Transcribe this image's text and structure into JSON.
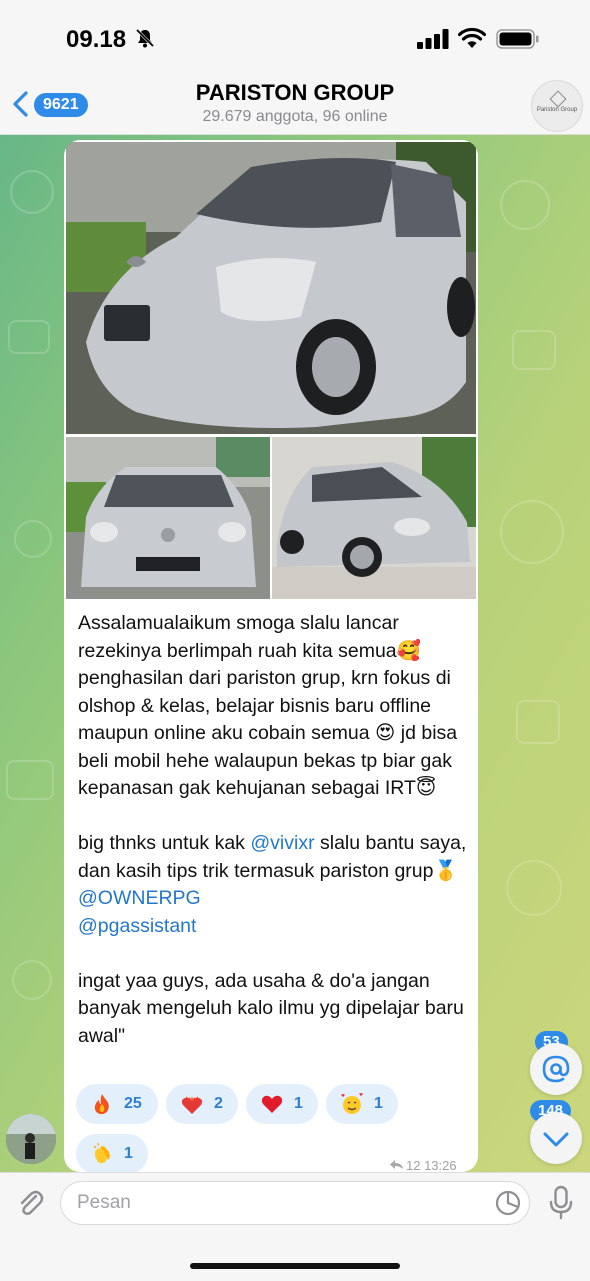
{
  "status_bar": {
    "time": "09.18"
  },
  "header": {
    "back_badge": "9621",
    "title": "PARISTON GROUP",
    "subtitle": "29.679 anggota, 96 online",
    "avatar_text": "Pariston Group"
  },
  "message": {
    "paragraph1": "Assalamualaikum smoga slalu lancar rezekinya berlimpah ruah kita semua🥰 penghasilan dari pariston grup, krn fokus di olshop & kelas, belajar bisnis baru offline maupun online aku cobain semua 😍 jd bisa beli mobil hehe walaupun bekas tp biar gak kepanasan gak kehujanan sebagai IRT😇",
    "p2_before": "big thnks untuk kak ",
    "mention1": "@vivixr",
    "p2_mid": " slalu bantu saya, dan kasih tips trik termasuk pariston grup🥇 ",
    "mention2": "@OWNERPG",
    "mention3": "@pgassistant",
    "paragraph3": "ingat yaa guys, ada usaha & do'a jangan banyak mengeluh kalo ilmu yg dipelajar baru awal\"",
    "reactions": [
      {
        "emoji": "fire-icon",
        "count": "25"
      },
      {
        "emoji": "heart-on-fire-icon",
        "count": "2"
      },
      {
        "emoji": "red-heart-icon",
        "count": "1"
      },
      {
        "emoji": "smiling-face-with-hearts-icon",
        "count": "1"
      },
      {
        "emoji": "clapping-hands-icon",
        "count": "1"
      }
    ],
    "meta": "12  13:26"
  },
  "floating": {
    "mentions_count": "53",
    "unread_count": "148"
  },
  "input": {
    "placeholder": "Pesan"
  },
  "colors": {
    "accent": "#2f8be8",
    "mention": "#2378c9",
    "reaction_bg": "#e3effb"
  }
}
